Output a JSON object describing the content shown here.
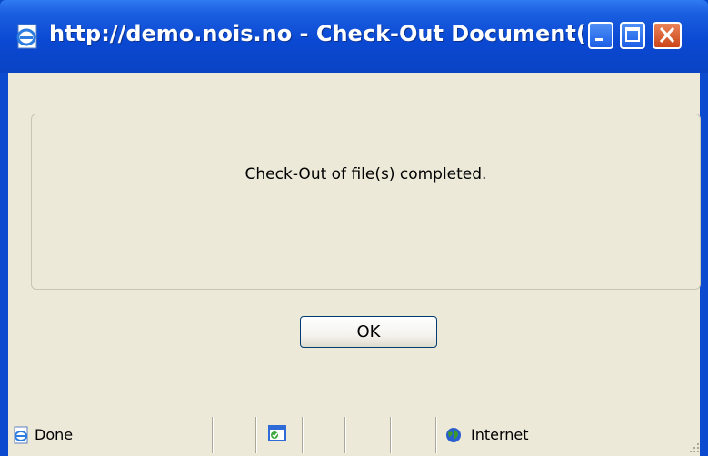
{
  "window": {
    "title": "http://demo.nois.no - Check-Out Document(...",
    "controls": {
      "minimize_icon": "minimize-icon",
      "maximize_icon": "maximize-icon",
      "close_icon": "close-icon"
    }
  },
  "dialog": {
    "message": "Check-Out of file(s) completed.",
    "ok_label": "OK"
  },
  "statusbar": {
    "status_text": "Done",
    "zone_text": "Internet"
  },
  "colors": {
    "titlebar": "#0b49d3",
    "client_bg": "#ece9d8",
    "close_button": "#cc4419"
  }
}
